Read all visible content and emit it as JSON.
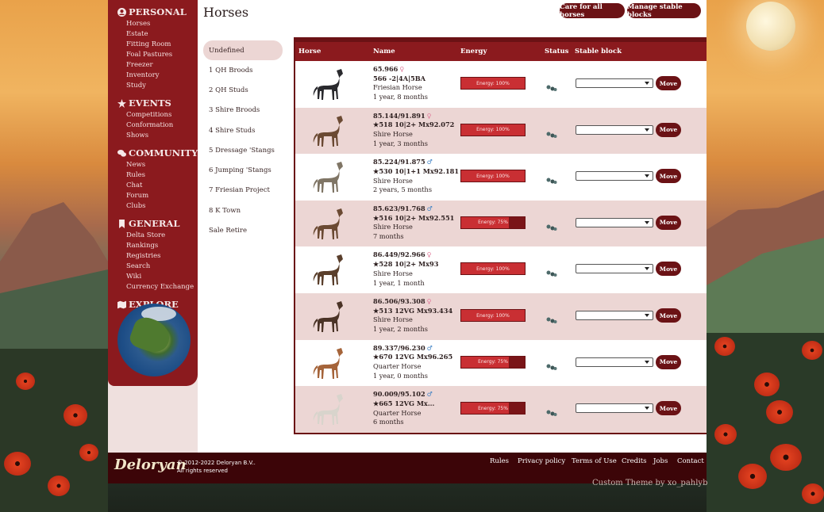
{
  "page": {
    "title": "Horses"
  },
  "toolbar": {
    "care_all": "Care for all horses",
    "manage_blocks": "Manage stable blocks"
  },
  "sidebar": {
    "sections": [
      {
        "heading": "PERSONAL",
        "icon": "user-circle-icon",
        "links": [
          "Horses",
          "Estate",
          "Fitting Room",
          "Foal Pastures",
          "Freezer",
          "Inventory",
          "Study"
        ]
      },
      {
        "heading": "EVENTS",
        "icon": "star-icon",
        "links": [
          "Competitions",
          "Conformation Shows"
        ]
      },
      {
        "heading": "COMMUNITY",
        "icon": "chat-bubbles-icon",
        "links": [
          "News",
          "Rules",
          "Chat",
          "Forum",
          "Clubs"
        ]
      },
      {
        "heading": "GENERAL",
        "icon": "bookmark-icon",
        "links": [
          "Delta Store",
          "Rankings",
          "Registries",
          "Search",
          "Wiki",
          "Currency Exchange"
        ]
      },
      {
        "heading": "EXPLORE",
        "icon": "map-icon",
        "links": []
      }
    ]
  },
  "groups": [
    "Undefined",
    "1 QH Broods",
    "2 QH Studs",
    "3 Shire Broods",
    "4 Shire Studs",
    "5 Dressage 'Stangs",
    "6 Jumping 'Stangs",
    "7 Friesian Project",
    "8 K Town",
    "Sale Retire"
  ],
  "active_group": "Undefined",
  "table": {
    "headers": {
      "horse": "Horse",
      "name": "Name",
      "energy": "Energy",
      "status": "Status",
      "stable_block": "Stable block"
    },
    "move_label": "Move",
    "rows": [
      {
        "line1": "65.966",
        "gender": "female",
        "line2": "566 -2|4A|5BA",
        "breed": "Friesian Horse",
        "age": "1 year, 8 months",
        "energy_label": "Energy: 100%",
        "energy": 1.0,
        "coat": "#2a2a2e"
      },
      {
        "line1": "85.144/91.891",
        "gender": "female",
        "line2": "★518 10|2+ Mx92.072",
        "breed": "Shire Horse",
        "age": "1 year, 3 months",
        "energy_label": "Energy: 100%",
        "energy": 1.0,
        "coat": "#6b4a33"
      },
      {
        "line1": "85.224/91.875",
        "gender": "male",
        "line2": "★530 10|1+1 Mx92.181",
        "breed": "Shire Horse",
        "age": "2 years, 5 months",
        "energy_label": "Energy: 100%",
        "energy": 1.0,
        "coat": "#7f7565"
      },
      {
        "line1": "85.623/91.768",
        "gender": "male",
        "line2": "★516 10|2+ Mx92.551",
        "breed": "Shire Horse",
        "age": "7 months",
        "energy_label": "Energy: 75%",
        "energy": 0.75,
        "coat": "#6b4a33"
      },
      {
        "line1": "86.449/92.966",
        "gender": "female",
        "line2": "★528 10|2+ Mx93",
        "breed": "Shire Horse",
        "age": "1 year, 1 month",
        "energy_label": "Energy: 100%",
        "energy": 1.0,
        "coat": "#5a3f2c"
      },
      {
        "line1": "86.506/93.308",
        "gender": "female",
        "line2": "★513 12VG Mx93.434",
        "breed": "Shire Horse",
        "age": "1 year, 2 months",
        "energy_label": "Energy: 100%",
        "energy": 1.0,
        "coat": "#4a3326"
      },
      {
        "line1": "89.337/96.230",
        "gender": "male",
        "line2": "★670 12VG Mx96.265",
        "breed": "Quarter Horse",
        "age": "1 year, 0 months",
        "energy_label": "Energy: 75%",
        "energy": 0.75,
        "coat": "#a5643a"
      },
      {
        "line1": "90.009/95.102",
        "gender": "male",
        "line2": "★665 12VG Mx...",
        "breed": "Quarter Horse",
        "age": "6 months",
        "energy_label": "Energy: 75%",
        "energy": 0.75,
        "coat": "#d8d4cc"
      }
    ]
  },
  "footer": {
    "logo": "Deloryan",
    "copyright_1": "© 2012-2022 Deloryan B.V..",
    "copyright_2": "All rights reserved",
    "links": [
      "Rules",
      "Privacy policy",
      "Terms of Use",
      "Credits",
      "Jobs",
      "Contact"
    ]
  },
  "custom_theme": "Custom Theme by xo_pahlyb",
  "colors": {
    "accent": "#8b1a1e",
    "dark": "#6b1215",
    "row_alt": "#ecd6d4",
    "footer": "#3c0508"
  }
}
